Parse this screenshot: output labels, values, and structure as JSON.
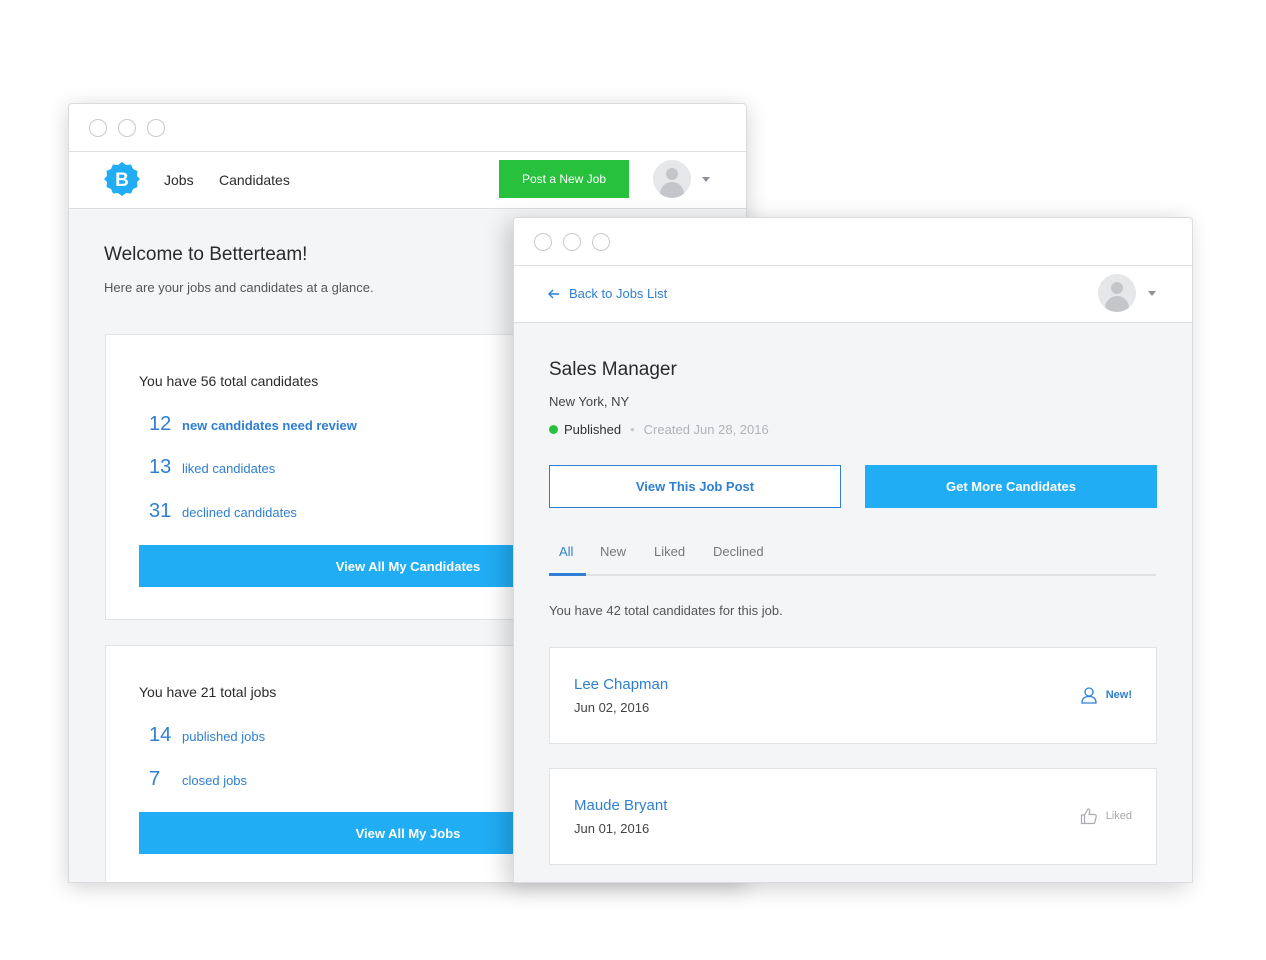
{
  "dashboard": {
    "logo_letter": "B",
    "nav": {
      "jobs": "Jobs",
      "candidates": "Candidates"
    },
    "post_button": "Post a New Job",
    "welcome_title": "Welcome to Betterteam!",
    "welcome_sub": "Here are your jobs and candidates at a glance.",
    "candidates_card": {
      "title": "You have 56 total candidates",
      "stats": [
        {
          "num": "12",
          "label": "new candidates need review"
        },
        {
          "num": "13",
          "label": "liked candidates"
        },
        {
          "num": "31",
          "label": "declined candidates"
        }
      ],
      "button": "View All My Candidates"
    },
    "jobs_card": {
      "title": "You have 21 total jobs",
      "stats": [
        {
          "num": "14",
          "label": "published jobs"
        },
        {
          "num": "7",
          "label": "closed jobs"
        }
      ],
      "button": "View All My Jobs"
    }
  },
  "job_detail": {
    "back_link": "Back to Jobs List",
    "title": "Sales Manager",
    "location": "New York, NY",
    "status": "Published",
    "separator": "•",
    "created": "Created Jun 28, 2016",
    "view_post_button": "View This Job Post",
    "more_candidates_button": "Get More Candidates",
    "tabs": [
      "All",
      "New",
      "Liked",
      "Declined"
    ],
    "candidate_count": "You have 42 total candidates for this job.",
    "candidates": [
      {
        "name": "Lee Chapman",
        "date": "Jun 02, 2016",
        "badge": "New!",
        "badge_icon": "user-icon"
      },
      {
        "name": "Maude Bryant",
        "date": "Jun 01, 2016",
        "badge": "Liked",
        "badge_icon": "thumbs-up-icon"
      }
    ]
  },
  "colors": {
    "accent_blue": "#20adf3",
    "link_blue": "#2e7fd3",
    "success_green": "#27c13d",
    "background": "#f4f5f7"
  }
}
